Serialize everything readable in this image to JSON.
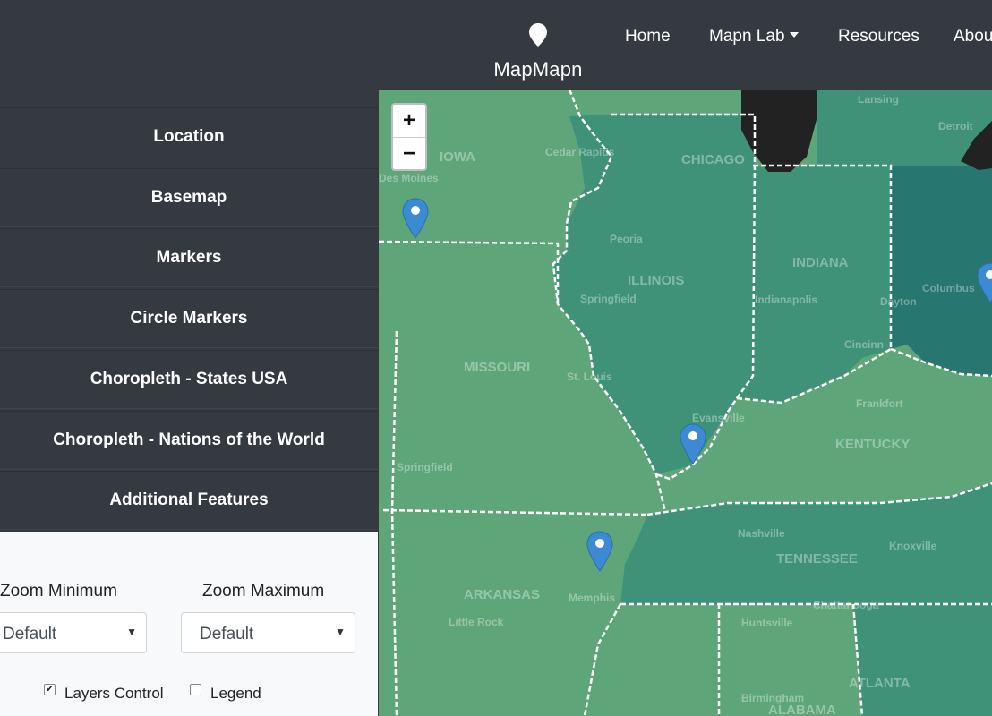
{
  "navbar": {
    "brand": "MapMapn",
    "links": [
      "Home",
      "Mapn Lab",
      "Resources",
      "About"
    ]
  },
  "sidebar": {
    "items": [
      "Location",
      "Basemap",
      "Markers",
      "Circle Markers",
      "Choropleth - States USA",
      "Choropleth - Nations of the World",
      "Additional Features"
    ]
  },
  "panel": {
    "zoom_min_label": "Zoom Minimum",
    "zoom_max_label": "Zoom Maximum",
    "zoom_min_value": "Default",
    "zoom_max_value": "Default",
    "layers_control_label": "Layers Control",
    "layers_control_checked": true,
    "legend_label": "Legend",
    "legend_checked": false
  },
  "map": {
    "zoom_in": "+",
    "zoom_out": "−",
    "states": [
      "IOWA",
      "ILLINOIS",
      "INDIANA",
      "MISSOURI",
      "KENTUCKY",
      "TENNESSEE",
      "ARKANSAS",
      "ALABAMA",
      "ATLANTA"
    ],
    "cities": [
      "Cedar Rapids",
      "Des Moines",
      "CHICAGO",
      "Lansing",
      "Detroit",
      "Peoria",
      "Springfield",
      "Indianapolis",
      "Columbus",
      "Dayton",
      "Cincinn",
      "St. Louis",
      "Frankfort",
      "Springfield",
      "Evansville",
      "Nashville",
      "Knoxville",
      "Memphis",
      "Little Rock",
      "Huntsville",
      "Chattanooga",
      "Birmingham"
    ],
    "colors": {
      "light": "#5ea67a",
      "medium": "#3f9278",
      "darker": "#2f8278",
      "dark": "#27766f",
      "lake": "#222222",
      "border": "#ffffff",
      "marker": "#3b8ad2"
    }
  }
}
